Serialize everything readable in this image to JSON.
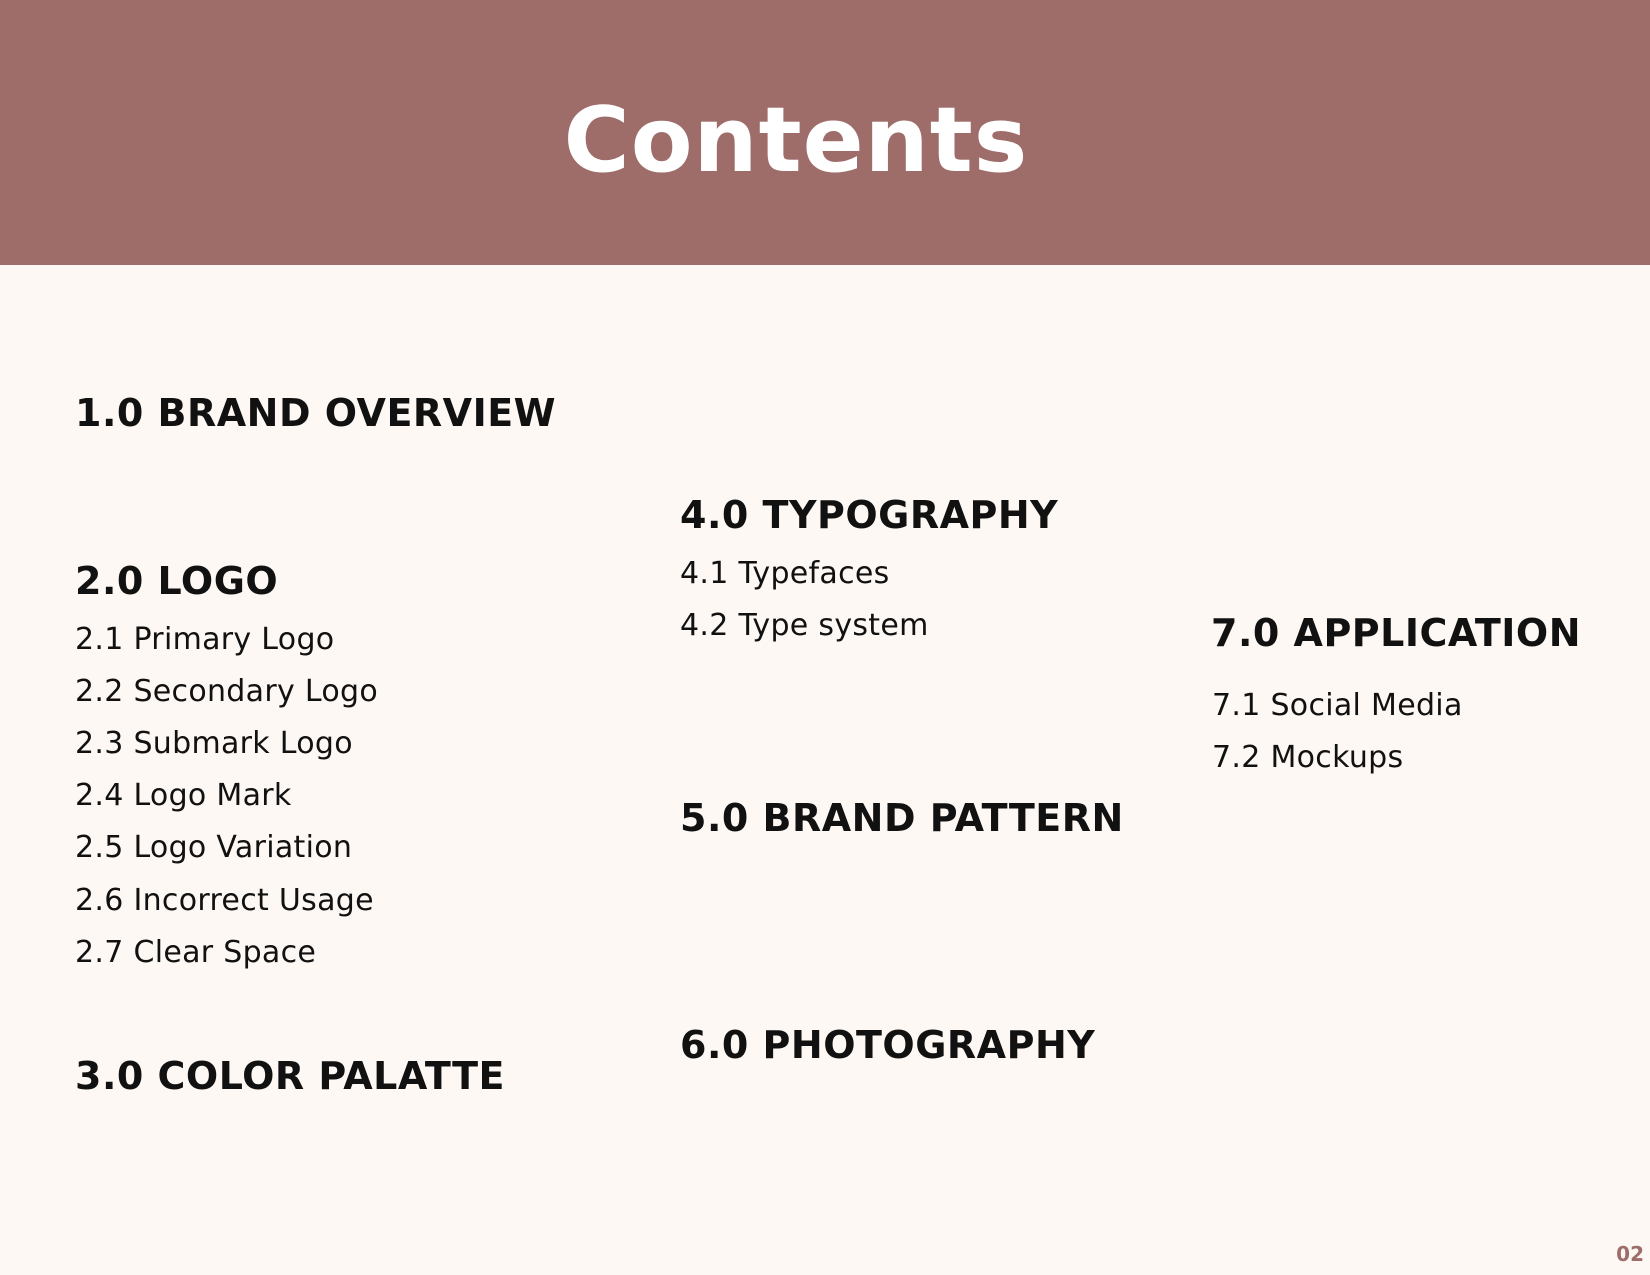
{
  "header": {
    "title": "Contents",
    "band_color": "#9e6c69"
  },
  "sections": {
    "s1": {
      "heading": "1.0 BRAND OVERVIEW"
    },
    "s2": {
      "heading": "2.0 LOGO",
      "items": [
        "2.1 Primary Logo",
        "2.2 Secondary Logo",
        "2.3 Submark Logo",
        "2.4 Logo Mark",
        "2.5 Logo Variation",
        "2.6 Incorrect Usage",
        "2.7 Clear Space"
      ]
    },
    "s3": {
      "heading": "3.0 COLOR PALATTE"
    },
    "s4": {
      "heading": "4.0 TYPOGRAPHY",
      "items": [
        "4.1 Typefaces",
        "4.2 Type system"
      ]
    },
    "s5": {
      "heading": "5.0 BRAND PATTERN"
    },
    "s6": {
      "heading": "6.0 PHOTOGRAPHY"
    },
    "s7": {
      "heading": "7.0 APPLICATION",
      "items": [
        "7.1 Social Media",
        "7.2 Mockups"
      ]
    }
  },
  "footer": {
    "page_number": "02"
  },
  "colors": {
    "background": "#fdf8f3",
    "accent": "#9e6c69",
    "text": "#111111"
  }
}
